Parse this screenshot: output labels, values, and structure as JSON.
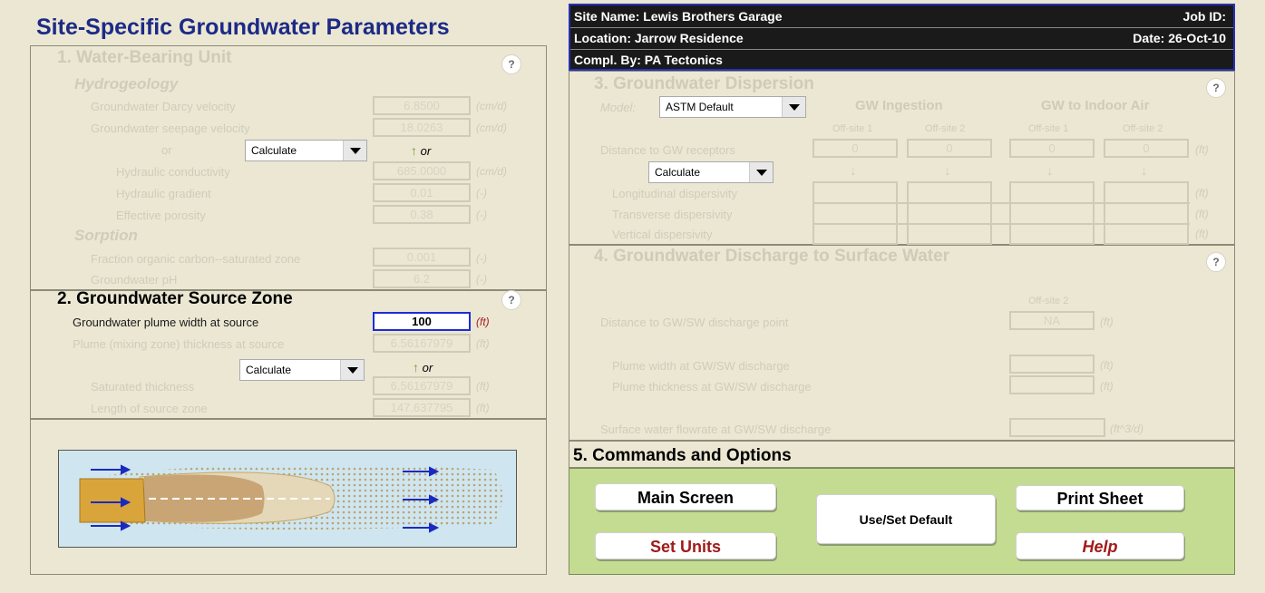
{
  "title": "Site-Specific Groundwater Parameters",
  "header": {
    "site_name": "Site Name:  Lewis Brothers Garage",
    "job_id": "Job ID:",
    "location": "Location:  Jarrow Residence",
    "date": "Date:  26-Oct-10",
    "compl_by": "Compl. By:  PA Tectonics"
  },
  "help_label": "?",
  "sec1": {
    "title": "1.  Water-Bearing Unit",
    "hydrogeology": "Hydrogeology",
    "darcy_label": "Groundwater Darcy velocity",
    "darcy_value": "6.8500",
    "darcy_unit": "(cm/d)",
    "seepage_label": "Groundwater seepage velocity",
    "seepage_value": "18.0263",
    "seepage_unit": "(cm/d)",
    "or": "or",
    "calc_select": "Calculate",
    "hydcond_label": "Hydraulic conductivity",
    "hydcond_value": "685.0000",
    "hydcond_unit": "(cm/d)",
    "gradient_label": "Hydraulic gradient",
    "gradient_value": "0.01",
    "gradient_unit": "(-)",
    "porosity_label": "Effective porosity",
    "porosity_value": "0.38",
    "porosity_unit": "(-)",
    "sorption": "Sorption",
    "foc_label": "Fraction organic carbon--saturated zone",
    "foc_value": "0.001",
    "foc_unit": "(-)",
    "ph_label": "Groundwater pH",
    "ph_value": "6.2",
    "ph_unit": "(-)"
  },
  "sec2": {
    "title": "2.  Groundwater Source Zone",
    "plume_width_label": "Groundwater plume width at source",
    "plume_width_value": "100",
    "plume_width_unit": "(ft)",
    "plume_thick_label": "Plume (mixing zone) thickness at source",
    "plume_thick_value": "6.56167979",
    "plume_thick_unit": "(ft)",
    "calc_select": "Calculate",
    "or": "or",
    "sat_label": "Saturated thickness",
    "sat_value": "6.56167979",
    "sat_unit": "(ft)",
    "len_label": "Length of source zone",
    "len_value": "147.637795",
    "len_unit": "(ft)"
  },
  "sec3": {
    "title": "3.  Groundwater Dispersion",
    "model_label": "Model:",
    "model_select": "ASTM Default",
    "gw_ingestion": "GW Ingestion",
    "gw_indoor": "GW to Indoor Air",
    "offsite1": "Off-site 1",
    "offsite2": "Off-site 2",
    "dist_label": "Distance to GW receptors",
    "dist_values": [
      "0",
      "0",
      "0",
      "0"
    ],
    "dist_unit": "(ft)",
    "calc_select": "Calculate",
    "long_label": "Longitudinal dispersivity",
    "trans_label": "Transverse dispersivity",
    "vert_label": "Vertical dispersivity",
    "unit": "(ft)"
  },
  "sec4": {
    "title": "4.  Groundwater Discharge to Surface Water",
    "offsite2": "Off-site 2",
    "dist_label": "Distance to GW/SW discharge point",
    "dist_value": "NA",
    "dist_unit": "(ft)",
    "pw_label": "Plume width at GW/SW discharge",
    "pw_unit": "(ft)",
    "pt_label": "Plume thickness at GW/SW discharge",
    "pt_unit": "(ft)",
    "flow_label": "Surface water flowrate at GW/SW discharge",
    "flow_unit": "(ft^3/d)"
  },
  "sec5": {
    "title": "5.  Commands and Options",
    "main_screen": "Main Screen",
    "set_units": "Set Units",
    "use_default": "Use/Set Default",
    "print_sheet": "Print Sheet",
    "help": "Help"
  },
  "colors": {
    "title_blue": "#1c2a86",
    "command_bg": "#c4dc92",
    "header_bg": "#1a1a1a"
  }
}
